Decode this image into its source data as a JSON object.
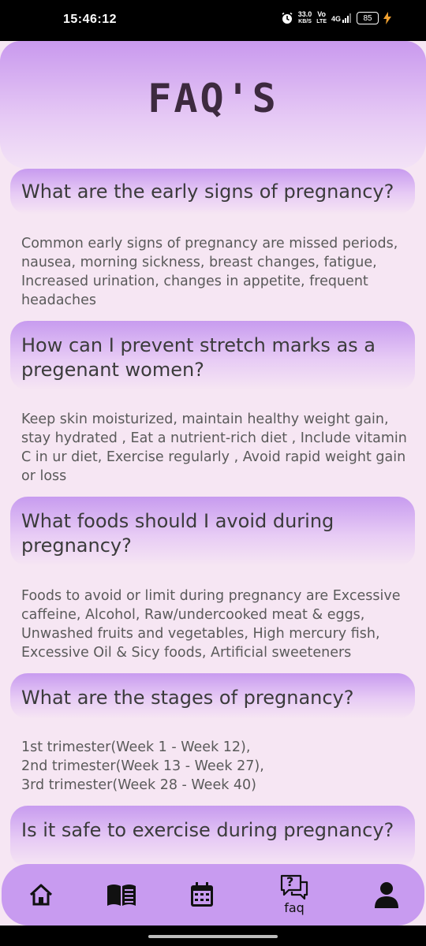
{
  "status_bar": {
    "time": "15:46:12",
    "network_speed": "33.0",
    "network_unit": "KB/S",
    "volte": "Vo",
    "lte": "LTE",
    "signal": "4G",
    "battery": "85"
  },
  "header": {
    "title": "FAQ'S"
  },
  "faqs": [
    {
      "question": "What are the early signs of pregnancy?",
      "answer": "Common early signs of pregnancy are missed periods, nausea, morning sickness, breast changes, fatigue, Increased urination, changes in appetite, frequent headaches"
    },
    {
      "question": "How can I prevent stretch marks as a pregenant women?",
      "answer": "Keep skin moisturized, maintain healthy weight gain, stay hydrated , Eat a nutrient-rich diet , Include vitamin C in ur diet, Exercise regularly , Avoid rapid weight gain or loss"
    },
    {
      "question": "What foods should I avoid during pregnancy?",
      "answer": "Foods to avoid or limit during pregnancy are Excessive caffeine, Alcohol, Raw/undercooked meat & eggs, Unwashed fruits and vegetables, High mercury fish, Excessive Oil & Sicy foods, Artificial sweeteners"
    },
    {
      "question": "What are the stages of pregnancy?",
      "answer": "1st trimester(Week 1 - Week 12), 2nd trimester(Week 13 - Week 27), 3rd trimester(Week 28 - Week 40)"
    },
    {
      "question": "Is it safe to exercise during pregnancy?",
      "answer": ""
    }
  ],
  "nav": {
    "faq_label": "faq",
    "faq_icon_text": "?"
  },
  "colors": {
    "accent": "#c89bf0",
    "background": "#f6e6f3"
  }
}
